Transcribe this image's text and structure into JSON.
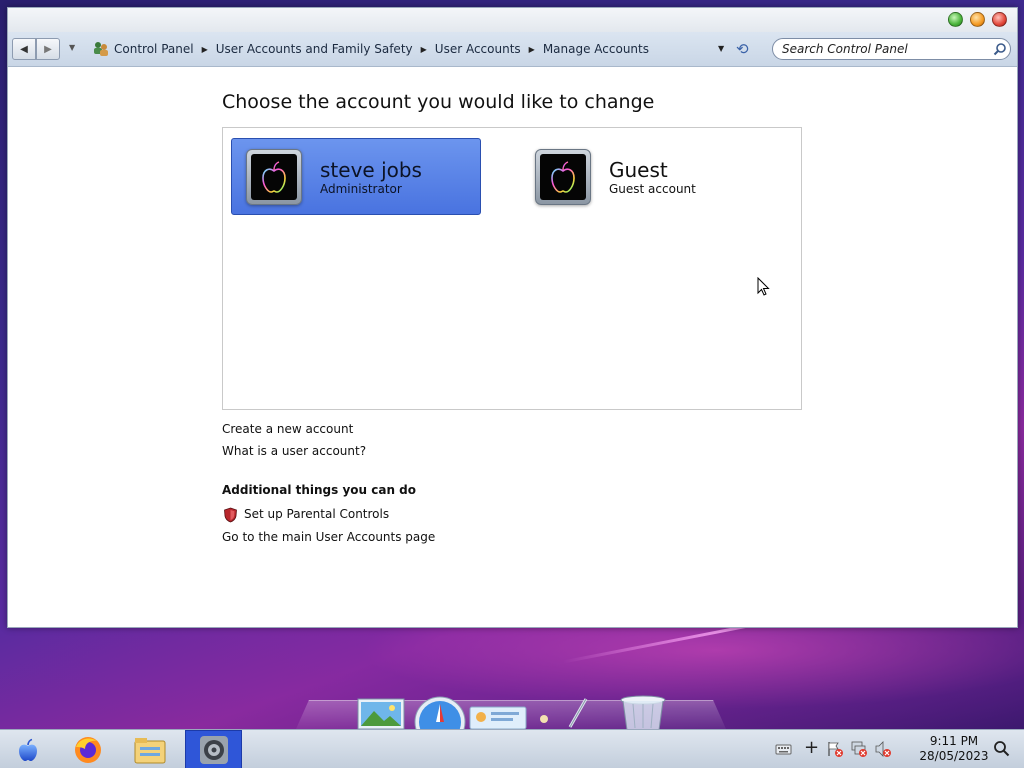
{
  "window": {
    "breadcrumb": [
      "Control Panel",
      "User Accounts and Family Safety",
      "User Accounts",
      "Manage Accounts"
    ],
    "search_placeholder": "Search Control Panel"
  },
  "page": {
    "title": "Choose the account you would like to change",
    "accounts": [
      {
        "name": "steve jobs",
        "role": "Administrator",
        "selected": true
      },
      {
        "name": "Guest",
        "role": "Guest account",
        "selected": false
      }
    ],
    "links": {
      "create_account": "Create a new account",
      "what_is_account": "What is a user account?"
    },
    "additional_heading": "Additional things you can do",
    "parental_controls": "Set up Parental Controls",
    "main_accounts_page": "Go to the main User Accounts page"
  },
  "taskbar": {
    "items": [
      "apple-icon",
      "firefox-icon",
      "file-explorer-icon",
      "system-preferences-icon"
    ],
    "clock_time": "9:11 PM",
    "clock_date": "28/05/2023"
  },
  "dock": {
    "items": [
      "photo-icon",
      "safari-icon",
      "id-card-icon",
      "pen-icon",
      "trash-icon"
    ]
  },
  "colors": {
    "selected_tile": "#5c85e8",
    "taskbar_active": "#2f56d8"
  }
}
